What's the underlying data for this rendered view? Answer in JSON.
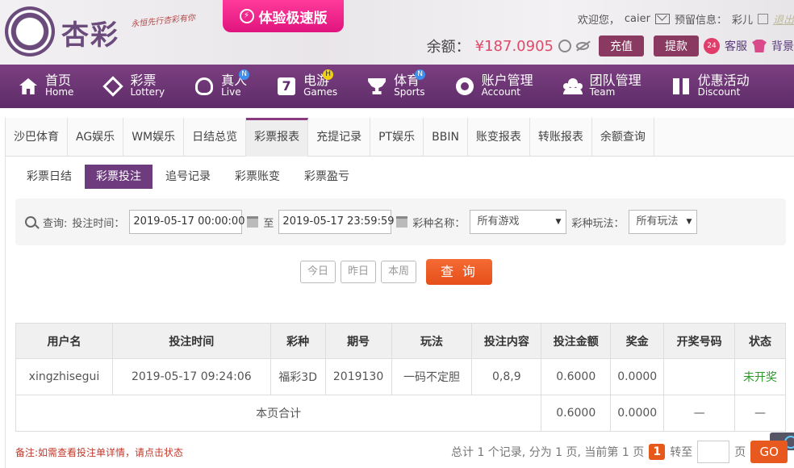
{
  "header": {
    "logo_text": "杏彩",
    "slogan": "永恒先行杏彩有你",
    "promo_label": "体验极速版",
    "welcome_label": "欢迎您，",
    "username": "caier",
    "notice_label": "预留信息：",
    "notice_value": "彩儿",
    "logout_label": "退出",
    "balance_label": "余额：",
    "balance_value": "¥187.0905",
    "recharge_label": "充值",
    "withdraw_label": "提款",
    "service_label": "客服",
    "skin_label": "背景"
  },
  "nav": [
    {
      "zh": "首页",
      "en": "Home",
      "icon": "home-icon",
      "badge": ""
    },
    {
      "zh": "彩票",
      "en": "Lottery",
      "icon": "ticket-icon",
      "badge": ""
    },
    {
      "zh": "真人",
      "en": "Live",
      "icon": "person-icon",
      "badge": "N"
    },
    {
      "zh": "电游",
      "en": "Games",
      "icon": "seven-icon",
      "badge": "H"
    },
    {
      "zh": "体育",
      "en": "Sports",
      "icon": "trophy-icon",
      "badge": "N"
    },
    {
      "zh": "账户管理",
      "en": "Account",
      "icon": "gear-icon",
      "badge": ""
    },
    {
      "zh": "团队管理",
      "en": "Team",
      "icon": "team-icon",
      "badge": ""
    },
    {
      "zh": "优惠活动",
      "en": "Discount",
      "icon": "gift-icon",
      "badge": ""
    }
  ],
  "tabs": [
    "沙巴体育",
    "AG娱乐",
    "WM娱乐",
    "日结总览",
    "彩票报表",
    "充提记录",
    "PT娱乐",
    "BBIN",
    "账变报表",
    "转账报表",
    "余额查询"
  ],
  "active_tab": "彩票报表",
  "subtabs": [
    "彩票日结",
    "彩票投注",
    "追号记录",
    "彩票账变",
    "彩票盈亏"
  ],
  "active_subtab": "彩票投注",
  "filter": {
    "query_label": "查询:",
    "time_label": "投注时间：",
    "start_time": "2019-05-17 00:00:00",
    "to_label": "至",
    "end_time": "2019-05-17 23:59:59",
    "game_label": "彩种名称：",
    "game_value": "所有游戏",
    "play_label": "彩种玩法：",
    "play_value": "所有玩法"
  },
  "quick": {
    "today": "今日",
    "yesterday": "昨日",
    "week": "本周",
    "query": "查 询"
  },
  "table": {
    "headers": [
      "用户名",
      "投注时间",
      "彩种",
      "期号",
      "玩法",
      "投注内容",
      "投注金额",
      "奖金",
      "开奖号码",
      "状态"
    ],
    "rows": [
      [
        "xingzhisegui",
        "2019-05-17 09:24:06",
        "福彩3D",
        "2019130",
        "一码不定胆",
        "0,8,9",
        "0.6000",
        "0.0000",
        "",
        "未开奖"
      ]
    ],
    "summary": {
      "label": "本页合计",
      "amount": "0.6000",
      "bonus": "0.0000",
      "draw": "—",
      "status": "—"
    }
  },
  "footer": {
    "note": "备注:如需查看投注单详情，请点击状态",
    "pager_text": "总计 1 个记录, 分为 1 页, 当前第 1 页",
    "current_page": "1",
    "goto_label": "转至",
    "page_label": "页",
    "go_label": "GO"
  }
}
